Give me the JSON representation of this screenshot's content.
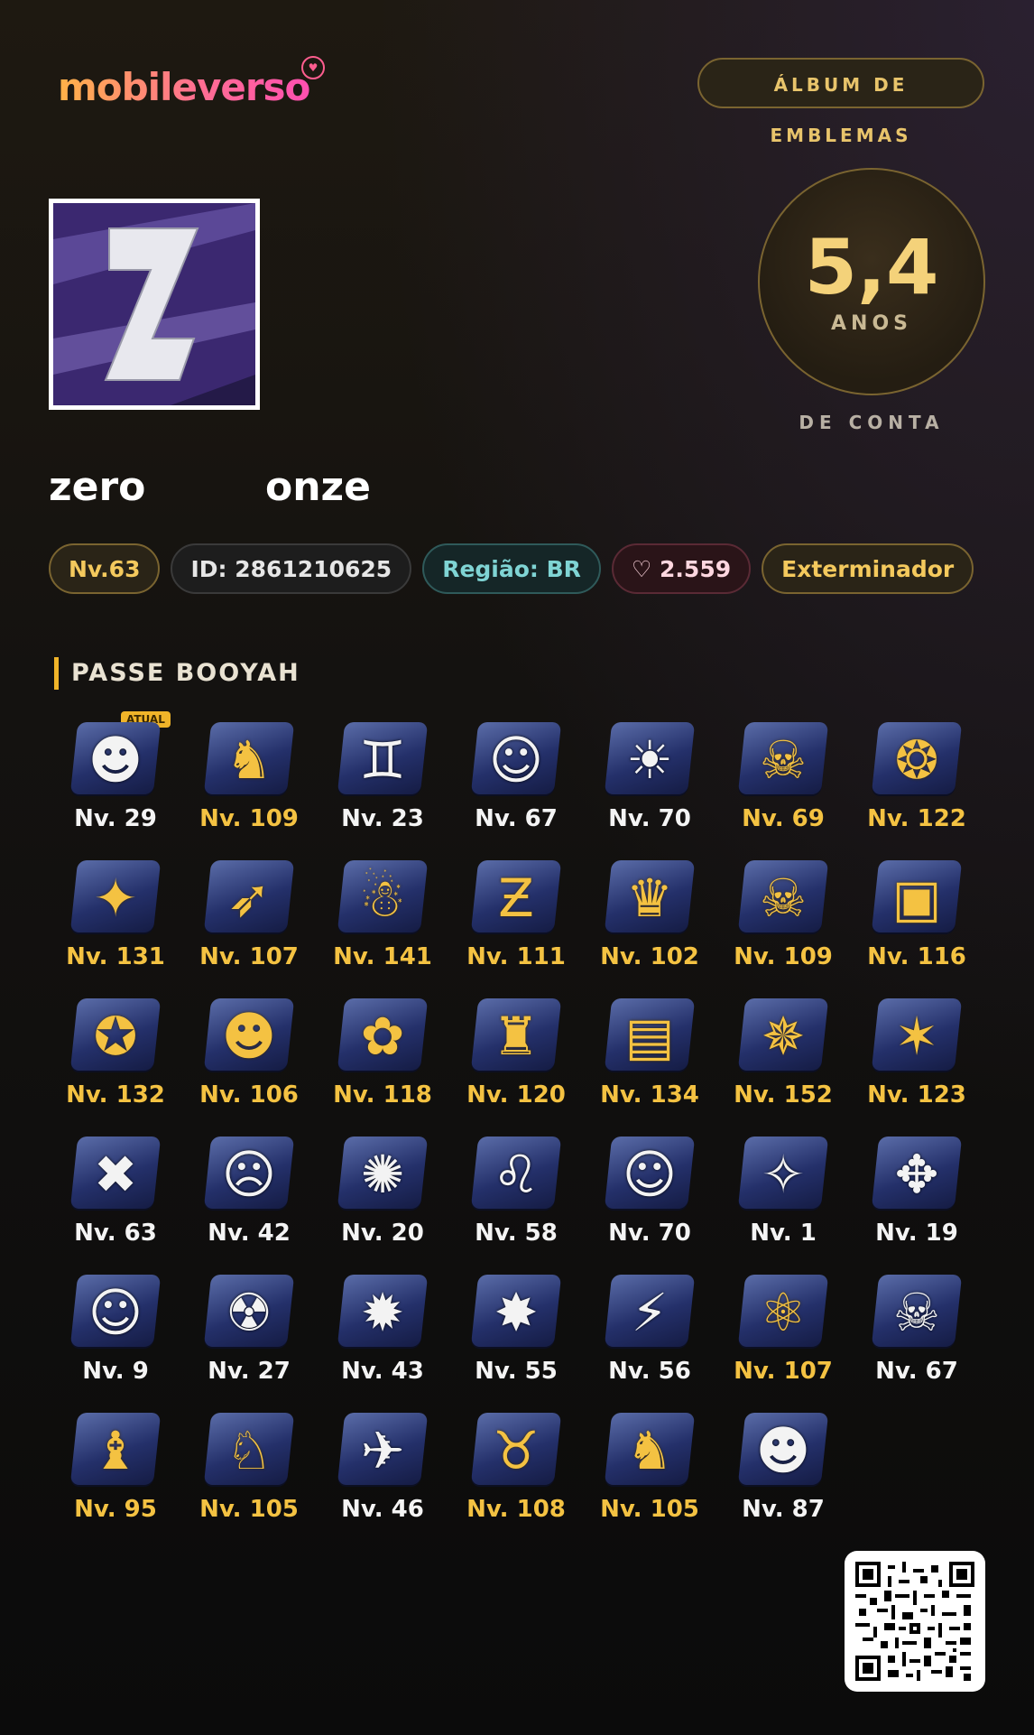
{
  "header": {
    "logo_text": "mobileverso",
    "logo_heart": "♥",
    "album_button": "ÁLBUM DE EMBLEMAS"
  },
  "profile": {
    "avatar_letter": "Z",
    "account_age": {
      "value": "5,4",
      "unit": "ANOS",
      "caption": "DE CONTA"
    },
    "nickname_left": "zero",
    "nickname_right": "onze",
    "chips": {
      "level": "Nv.63",
      "id": "ID: 2861210625",
      "region": "Região: BR",
      "likes_icon": "heart-outline-icon",
      "likes": "♡ 2.559",
      "title": "Exterminador"
    }
  },
  "booyah": {
    "section_title": "PASSE BOOYAH",
    "current_tag": "ATUAL",
    "emblems": [
      {
        "label": "Nv. 29",
        "tier": "white",
        "icon": "☻"
      },
      {
        "label": "Nv. 109",
        "tier": "gold",
        "icon": "♞"
      },
      {
        "label": "Nv. 23",
        "tier": "white",
        "icon": "♊"
      },
      {
        "label": "Nv. 67",
        "tier": "white",
        "icon": "☺"
      },
      {
        "label": "Nv. 70",
        "tier": "white",
        "icon": "☀"
      },
      {
        "label": "Nv. 69",
        "tier": "gold",
        "icon": "☠"
      },
      {
        "label": "Nv. 122",
        "tier": "gold",
        "icon": "❂"
      },
      {
        "label": "Nv. 131",
        "tier": "gold",
        "icon": "✦"
      },
      {
        "label": "Nv. 107",
        "tier": "gold",
        "icon": "➶"
      },
      {
        "label": "Nv. 141",
        "tier": "gold",
        "icon": "☃"
      },
      {
        "label": "Nv. 111",
        "tier": "gold",
        "icon": "Ƶ"
      },
      {
        "label": "Nv. 102",
        "tier": "gold",
        "icon": "♛"
      },
      {
        "label": "Nv. 109",
        "tier": "gold",
        "icon": "☠"
      },
      {
        "label": "Nv. 116",
        "tier": "gold",
        "icon": "▣"
      },
      {
        "label": "Nv. 132",
        "tier": "gold",
        "icon": "✪"
      },
      {
        "label": "Nv. 106",
        "tier": "gold",
        "icon": "☻"
      },
      {
        "label": "Nv. 118",
        "tier": "gold",
        "icon": "✿"
      },
      {
        "label": "Nv. 120",
        "tier": "gold",
        "icon": "♜"
      },
      {
        "label": "Nv. 134",
        "tier": "gold",
        "icon": "▤"
      },
      {
        "label": "Nv. 152",
        "tier": "gold",
        "icon": "✵"
      },
      {
        "label": "Nv. 123",
        "tier": "gold",
        "icon": "✶"
      },
      {
        "label": "Nv. 63",
        "tier": "white",
        "icon": "✖"
      },
      {
        "label": "Nv. 42",
        "tier": "white",
        "icon": "☹"
      },
      {
        "label": "Nv. 20",
        "tier": "white",
        "icon": "✺"
      },
      {
        "label": "Nv. 58",
        "tier": "white",
        "icon": "♌"
      },
      {
        "label": "Nv. 70",
        "tier": "white",
        "icon": "☺"
      },
      {
        "label": "Nv. 1",
        "tier": "white",
        "icon": "✧"
      },
      {
        "label": "Nv. 19",
        "tier": "white",
        "icon": "✥"
      },
      {
        "label": "Nv. 9",
        "tier": "white",
        "icon": "☺"
      },
      {
        "label": "Nv. 27",
        "tier": "white",
        "icon": "☢"
      },
      {
        "label": "Nv. 43",
        "tier": "white",
        "icon": "✹"
      },
      {
        "label": "Nv. 55",
        "tier": "white",
        "icon": "✸"
      },
      {
        "label": "Nv. 56",
        "tier": "white",
        "icon": "⚡"
      },
      {
        "label": "Nv. 107",
        "tier": "gold",
        "icon": "⚛"
      },
      {
        "label": "Nv. 67",
        "tier": "white",
        "icon": "☠"
      },
      {
        "label": "Nv. 95",
        "tier": "gold",
        "icon": "♝"
      },
      {
        "label": "Nv. 105",
        "tier": "gold",
        "icon": "♘"
      },
      {
        "label": "Nv. 46",
        "tier": "white",
        "icon": "✈"
      },
      {
        "label": "Nv. 108",
        "tier": "gold",
        "icon": "♉"
      },
      {
        "label": "Nv. 105",
        "tier": "gold",
        "icon": "♞"
      },
      {
        "label": "Nv. 87",
        "tier": "white",
        "icon": "☻"
      }
    ]
  },
  "qr_code": "qr-code-icon",
  "colors": {
    "gold": "#f4c242",
    "white": "#f4f4f4",
    "accent_border": "#7a6430"
  }
}
